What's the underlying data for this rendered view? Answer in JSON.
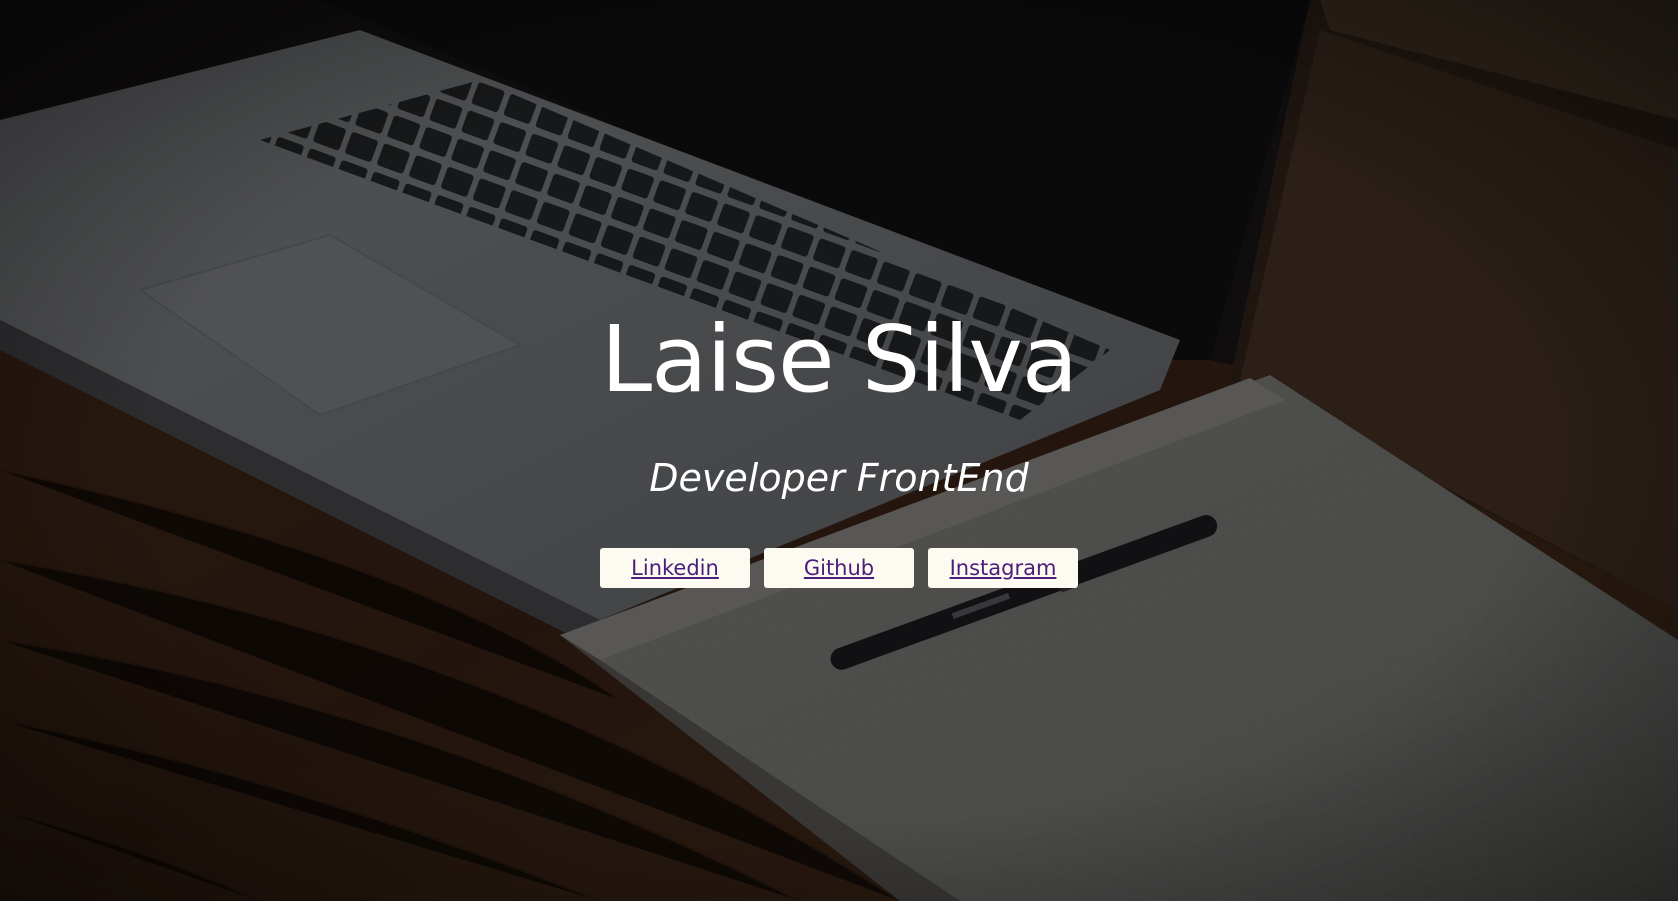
{
  "hero": {
    "name": "Laise Silva",
    "subtitle": "Developer FrontEnd",
    "background": "photo of a laptop, an open notebook and a pen on a wooden desk, darkened overlay"
  },
  "links": [
    {
      "label": "Linkedin"
    },
    {
      "label": "Github"
    },
    {
      "label": "Instagram"
    }
  ],
  "colors": {
    "title_text": "#ffffff",
    "button_bg": "#fdfaf1",
    "link_text": "#4b1d7a"
  }
}
